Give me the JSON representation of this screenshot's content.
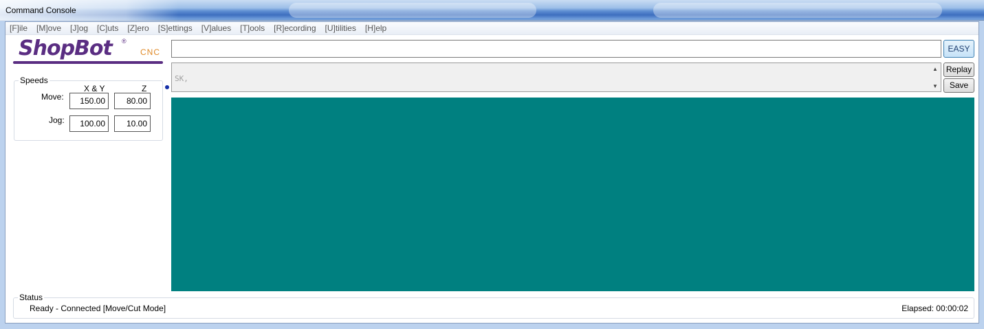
{
  "window": {
    "title": "Command Console"
  },
  "menu": [
    "[F]ile",
    "[M]ove",
    "[J]og",
    "[C]uts",
    "[Z]ero",
    "[S]ettings",
    "[V]alues",
    "[T]ools",
    "[R]ecording",
    "[U]tilities",
    "[H]elp"
  ],
  "logo": {
    "brand": "ShopBot",
    "registered": "®",
    "suffix": "CNC"
  },
  "speeds": {
    "legend": "Speeds",
    "col_xy": "X & Y",
    "col_z": "Z",
    "move_label": "Move:",
    "jog_label": "Jog:",
    "move_xy": "150.00",
    "move_z": "80.00",
    "jog_xy": "100.00",
    "jog_z": "10.00"
  },
  "command": {
    "value": "",
    "easy_label": "EASY"
  },
  "history": {
    "text": "SK,",
    "replay_label": "Replay",
    "save_label": "Save"
  },
  "status": {
    "legend": "Status",
    "text": "Ready - Connected  [Move/Cut Mode]",
    "elapsed": "Elapsed: 00:00:02"
  },
  "colors": {
    "display_bg": "#008080",
    "logo": "#5a2d82",
    "cnc": "#e08a28",
    "indicator_dot": "#1530a8"
  }
}
